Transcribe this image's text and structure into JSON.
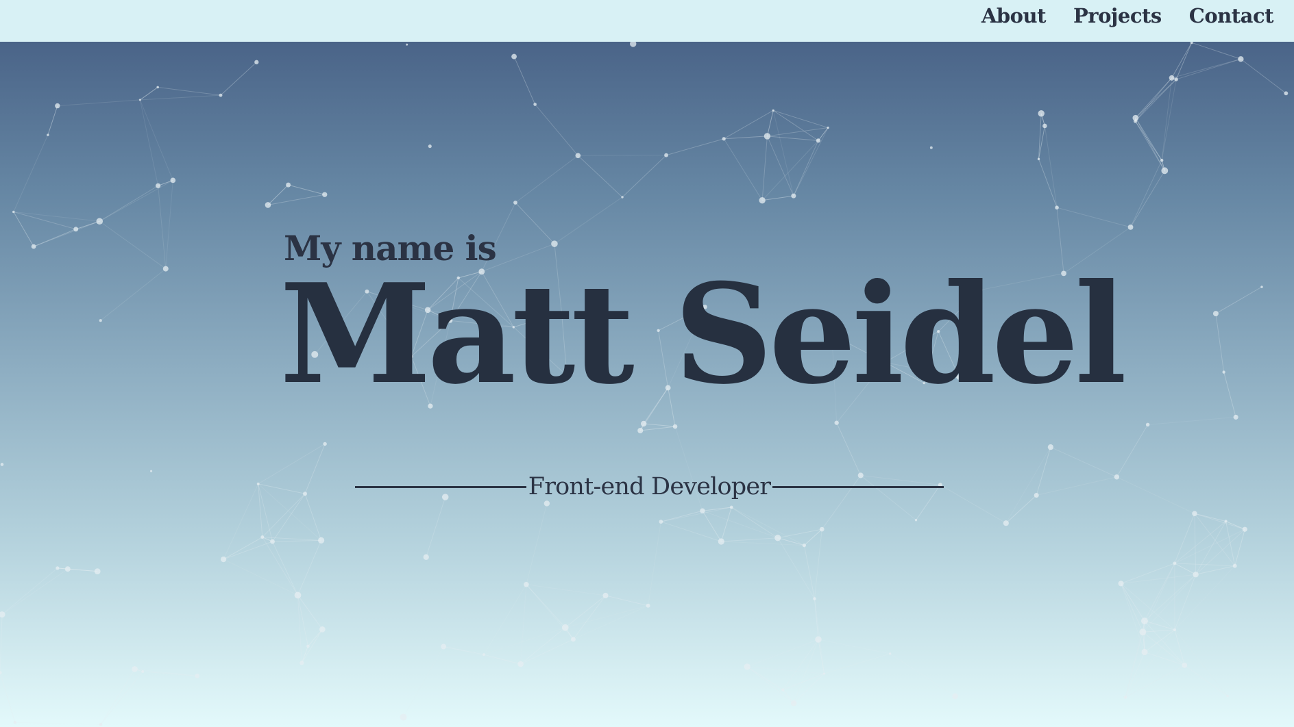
{
  "nav": {
    "links": [
      {
        "label": "About"
      },
      {
        "label": "Projects"
      },
      {
        "label": "Contact"
      }
    ]
  },
  "hero": {
    "intro": "My name is",
    "name": "Matt Seidel",
    "role": "Front-end Developer"
  },
  "colors": {
    "text_dark": "#263040",
    "nav_bg": "#d8f1f5",
    "gradient_top": "#4a6488",
    "gradient_bottom": "#e3f9fb",
    "particle": "#e6eef2"
  }
}
